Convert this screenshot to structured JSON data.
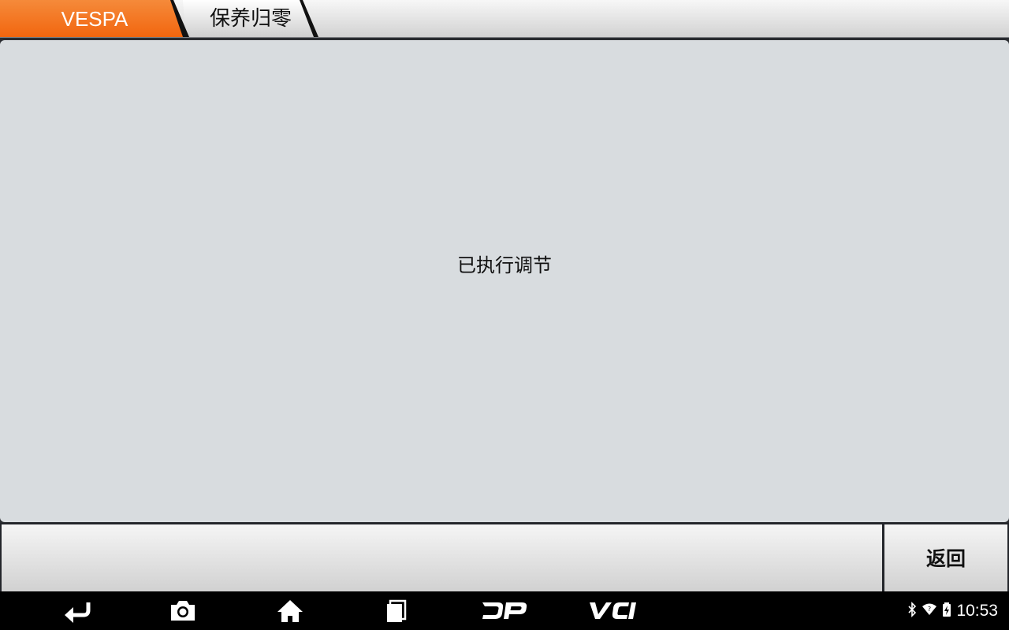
{
  "breadcrumb": {
    "brand": "VESPA",
    "function": "保养归零"
  },
  "main": {
    "message": "已执行调节"
  },
  "buttons": {
    "back_label": "返回"
  },
  "navbar": {
    "icons": [
      "back-icon",
      "screenshot-icon",
      "home-icon",
      "recent-apps-icon",
      "dp-icon",
      "vci-icon"
    ]
  },
  "status_bar": {
    "time": "10:53",
    "icons": [
      "bluetooth-icon",
      "wifi-icon",
      "battery-icon"
    ]
  },
  "colors": {
    "accent": "#f26b1d",
    "panel": "#d8dcdf",
    "navbar": "#000000"
  }
}
